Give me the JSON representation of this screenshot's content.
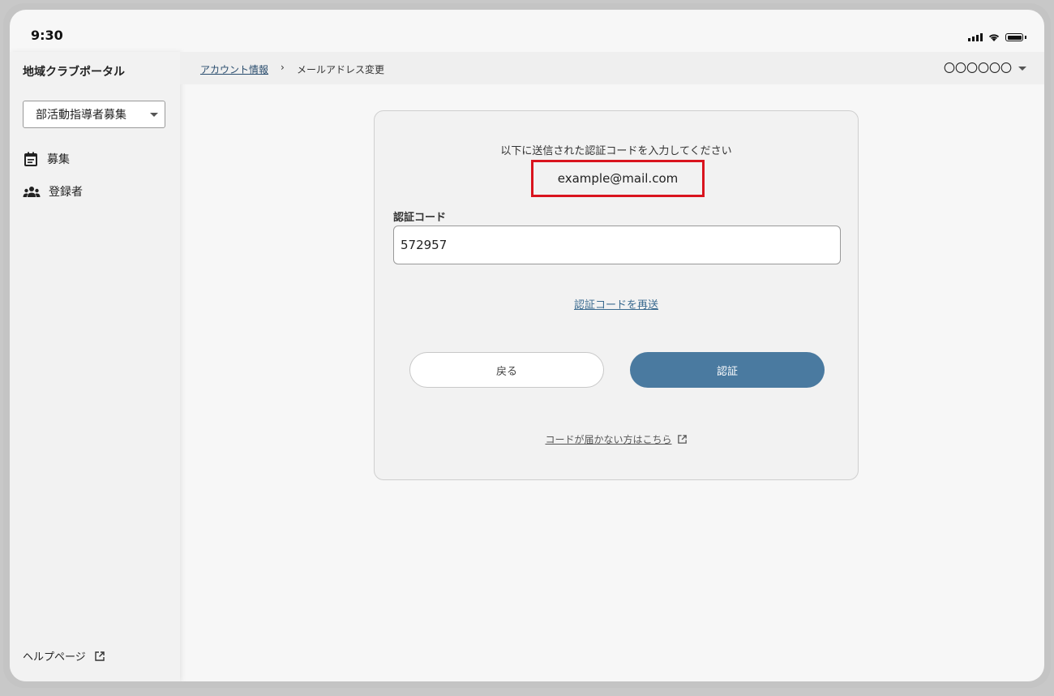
{
  "status_bar": {
    "time": "9:30"
  },
  "sidebar": {
    "title": "地域クラブポータル",
    "selector": {
      "value": "部活動指導者募集"
    },
    "items": [
      {
        "label": "募集",
        "icon": "calendar-icon"
      },
      {
        "label": "登録者",
        "icon": "people-icon"
      }
    ],
    "help": {
      "label": "ヘルプページ",
      "icon": "external-link-icon"
    }
  },
  "header": {
    "breadcrumb": {
      "parent": "アカウント情報",
      "separator": "›",
      "current": "メールアドレス変更"
    },
    "user_name": "〇〇〇〇〇〇"
  },
  "verification": {
    "instruction": "以下に送信された認証コードを入力してください",
    "email": "example@mail.com",
    "highlight_color": "#d9141e",
    "code_label": "認証コード",
    "code_value": "572957",
    "resend_label": "認証コードを再送",
    "back_label": "戻る",
    "verify_label": "認証",
    "verify_color": "#4a7aa0",
    "no_code_label": "コードが届かない方はこちら"
  }
}
